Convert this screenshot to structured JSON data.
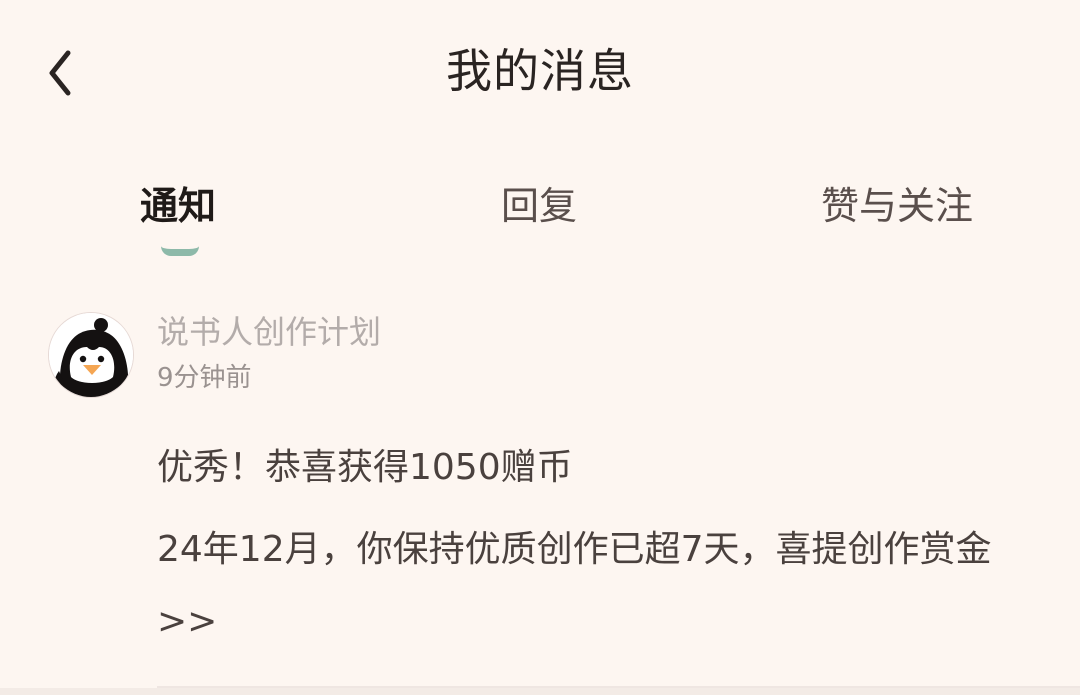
{
  "header": {
    "title": "我的消息",
    "back_icon": "chevron-left-icon"
  },
  "tabs": [
    {
      "label": "通知",
      "active": true
    },
    {
      "label": "回复",
      "active": false
    },
    {
      "label": "赞与关注",
      "active": false
    }
  ],
  "colors": {
    "background": "#fdf6f1",
    "tab_indicator": "#8db9a9",
    "avatar_beak": "#f5a653"
  },
  "messages": [
    {
      "sender": "说书人创作计划",
      "time": "9分钟前",
      "avatar_icon": "penguin-avatar-icon",
      "title": "优秀！恭喜获得1050赠币",
      "body": "24年12月，你保持优质创作已超7天，喜提创作赏金>>"
    }
  ]
}
